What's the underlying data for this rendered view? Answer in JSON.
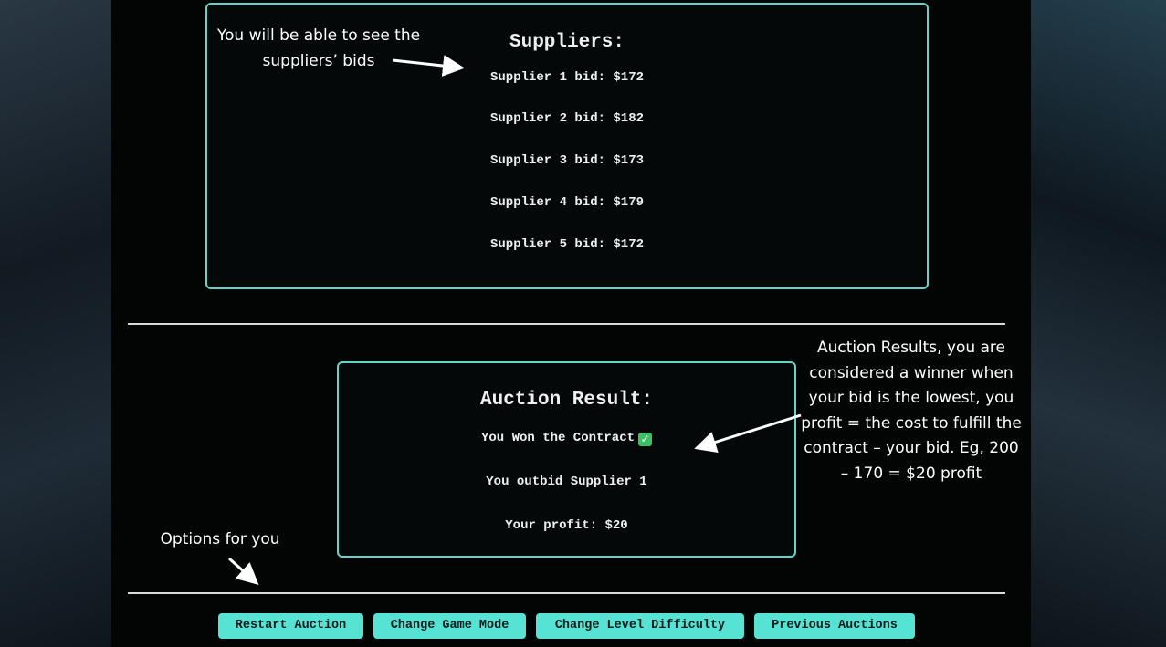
{
  "suppliers_panel": {
    "title": "Suppliers:",
    "bids": [
      "Supplier 1 bid: $172",
      "Supplier 2 bid: $182",
      "Supplier 3 bid: $173",
      "Supplier 4 bid: $179",
      "Supplier 5 bid: $172"
    ]
  },
  "result_panel": {
    "title": "Auction Result:",
    "won_text": "You Won the Contract",
    "check_icon": "✓",
    "outbid_text": "You outbid Supplier 1",
    "profit_text": "Your profit: $20"
  },
  "buttons": {
    "restart": "Restart Auction",
    "change_mode": "Change Game Mode",
    "change_difficulty": "Change Level Difficulty",
    "previous": "Previous Auctions"
  },
  "annotations": {
    "suppliers_line1": "You will be able to see the",
    "suppliers_line2": "suppliers’ bids",
    "results_lines": [
      "Auction Results, you are",
      "considered a winner when",
      "your bid is the lowest, you",
      "profit = the cost to fulfill the",
      "contract – your bid. Eg, 200",
      "– 170 = $20 profit"
    ],
    "options": "Options for you"
  },
  "colors": {
    "accent": "#56e3d3",
    "panel_border": "#5fd6c9",
    "success": "#3fbf66"
  }
}
